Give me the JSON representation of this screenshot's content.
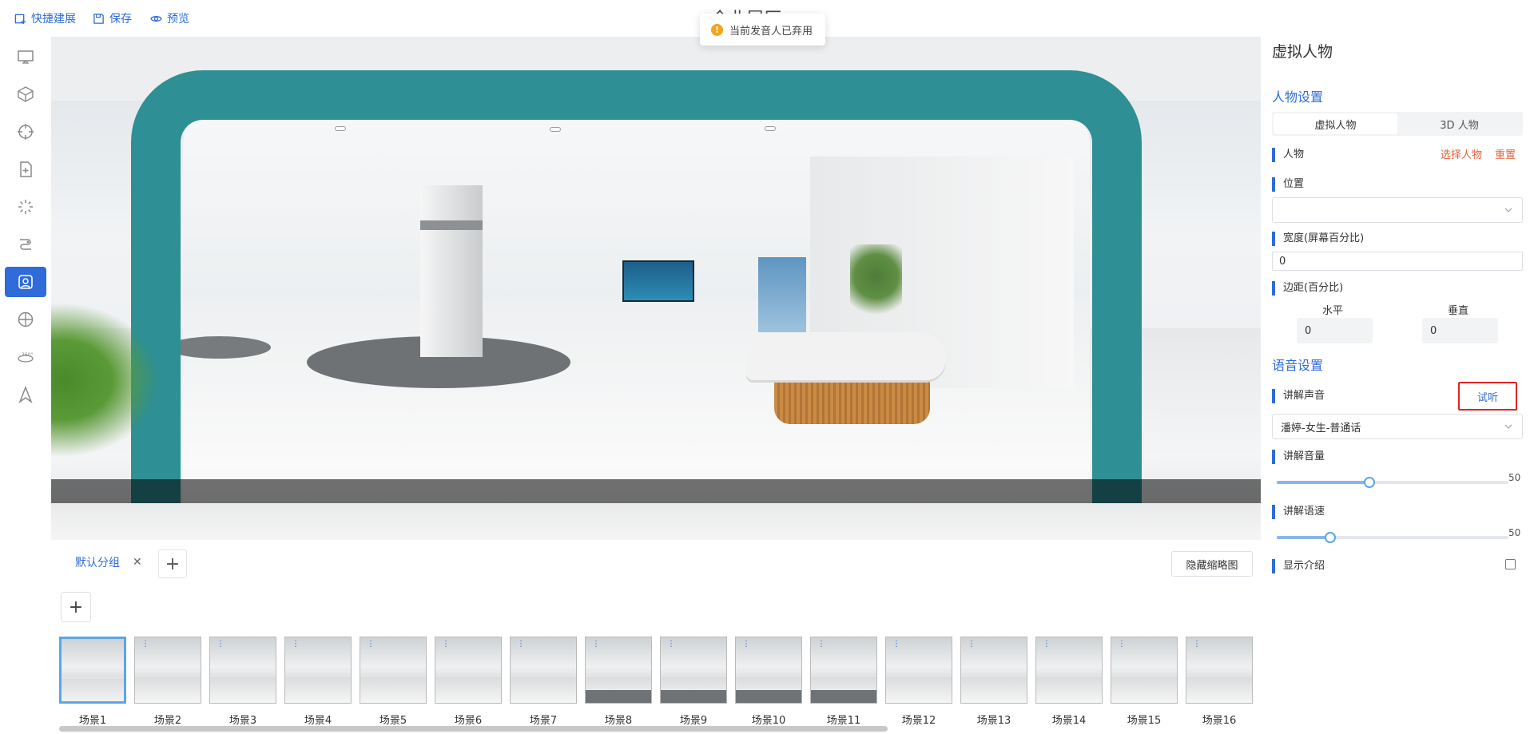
{
  "toolbar": {
    "quick_build": "快捷建展",
    "save": "保存",
    "preview": "预览",
    "title_partial": "企业展厅"
  },
  "toast": {
    "text": "当前发音人已弃用",
    "icon": "warning-icon"
  },
  "sidebar": {
    "items": [
      {
        "name": "screen-icon"
      },
      {
        "name": "cube-icon"
      },
      {
        "name": "target-icon"
      },
      {
        "name": "add-file-icon"
      },
      {
        "name": "loading-icon"
      },
      {
        "name": "effects-icon"
      },
      {
        "name": "avatar-icon",
        "active": true
      },
      {
        "name": "grid-icon"
      },
      {
        "name": "360-icon",
        "label": "360°"
      },
      {
        "name": "navigate-icon"
      }
    ],
    "active_color": "#2f6bd9"
  },
  "groups": {
    "tab_label": "默认分组",
    "hide_thumbnails": "隐藏缩略图"
  },
  "scenes": [
    {
      "label": "场景1",
      "selected": true
    },
    {
      "label": "场景2"
    },
    {
      "label": "场景3"
    },
    {
      "label": "场景4"
    },
    {
      "label": "场景5"
    },
    {
      "label": "场景6"
    },
    {
      "label": "场景7"
    },
    {
      "label": "场景8"
    },
    {
      "label": "场景9"
    },
    {
      "label": "场景10"
    },
    {
      "label": "场景11"
    },
    {
      "label": "场景12"
    },
    {
      "label": "场景13"
    },
    {
      "label": "场景14"
    },
    {
      "label": "场景15"
    },
    {
      "label": "场景16"
    }
  ],
  "panel": {
    "title": "虚拟人物",
    "character_settings": "人物设置",
    "seg_virtual": "虚拟人物",
    "seg_3d": "3D 人物",
    "character_label": "人物",
    "select_character": "选择人物",
    "reset": "重置",
    "position_label": "位置",
    "position_value": "",
    "width_label": "宽度(屏幕百分比)",
    "width_value": "0",
    "margin_label": "边距(百分比)",
    "margin_horizontal": "水平",
    "margin_vertical": "垂直",
    "margin_h_value": "0",
    "margin_v_value": "0",
    "voice_settings": "语音设置",
    "voice_label": "讲解声音",
    "try_listen": "试听",
    "voice_value": "潘婷-女生-普通话",
    "volume_label": "讲解音量",
    "volume_value": "50",
    "volume_fraction": 0.4,
    "speed_label": "讲解语速",
    "speed_value": "50",
    "speed_fraction": 0.23,
    "show_intro_label": "显示介绍",
    "show_intro_checked": false
  },
  "colors": {
    "accent": "#2f6bd9",
    "warning": "#f3a51c",
    "link_red": "#e2623a",
    "highlight_border": "#e02424",
    "arch_teal": "#2e8f94"
  }
}
